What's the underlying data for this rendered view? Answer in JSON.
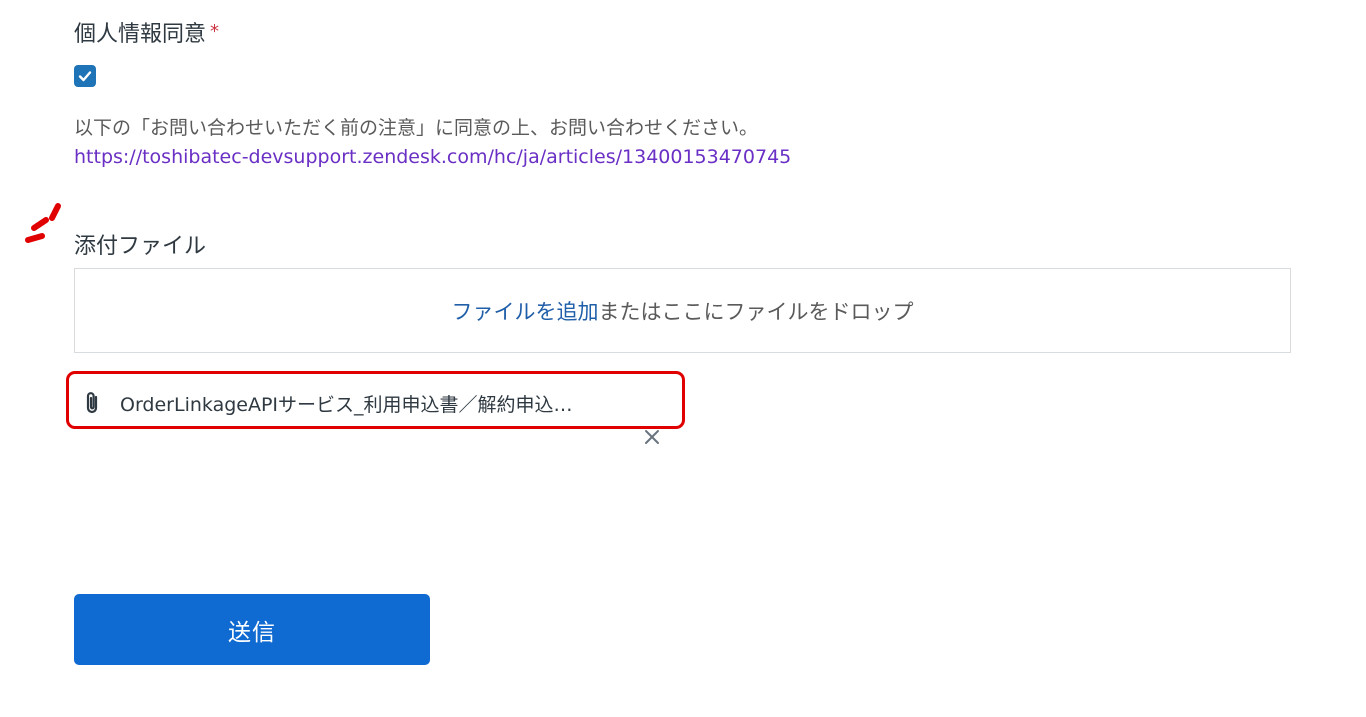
{
  "consent": {
    "label": "個人情報同意",
    "required_mark": "*",
    "checked": true,
    "description": "以下の「お問い合わせいただく前の注意」に同意の上、お問い合わせください。",
    "link_text": "https://toshibatec-devsupport.zendesk.com/hc/ja/articles/13400153470745"
  },
  "attachment": {
    "label": "添付ファイル",
    "add_file_link": "ファイルを追加",
    "drop_text": "またはここにファイルをドロップ",
    "files": [
      {
        "name": "OrderLinkageAPIサービス_利用申込書／解約申込…",
        "icon": "paperclip-icon",
        "remove_icon": "close-icon"
      }
    ]
  },
  "submit": {
    "label": "送信"
  },
  "colors": {
    "accent": "#1f73b7",
    "button": "#0f6ad1",
    "link": "#6a2fc4",
    "highlight": "#e00000"
  }
}
